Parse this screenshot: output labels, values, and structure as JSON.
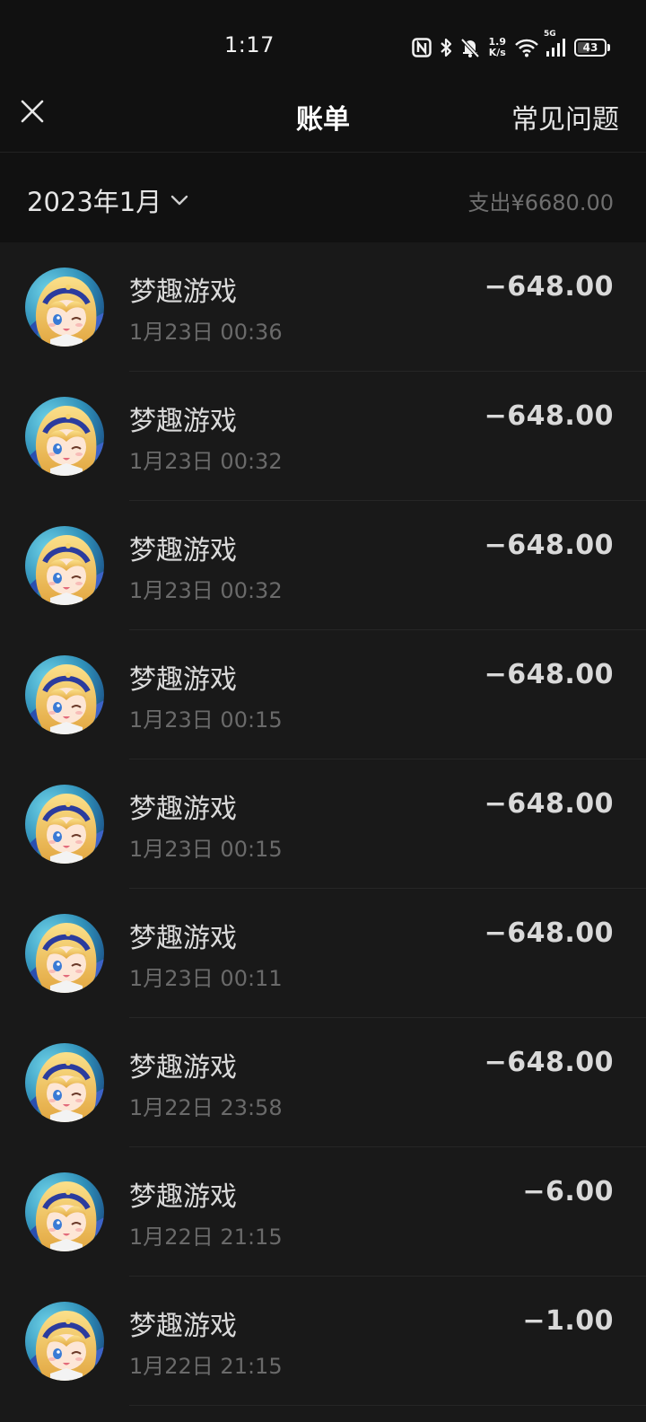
{
  "status_bar": {
    "time": "1:17",
    "net_speed_value": "1.9",
    "net_speed_unit": "K/s",
    "signal_label": "5G",
    "battery": "43",
    "icons": [
      "nfc-icon",
      "bluetooth-icon",
      "mute-bell-icon",
      "wifi-icon",
      "cellular-icon",
      "battery-icon"
    ]
  },
  "header": {
    "close_icon": "close-icon",
    "title": "账单",
    "faq_label": "常见问题"
  },
  "summary": {
    "month_label": "2023年1月",
    "month_icon": "chevron-down-icon",
    "expense_label": "支出¥6680.00"
  },
  "colors": {
    "background": "#191919",
    "header_bg": "#111111",
    "primary_text": "#dadada",
    "secondary_text": "#6a6a6a"
  },
  "bills": [
    {
      "merchant": "梦趣游戏",
      "time": "1月23日 00:36",
      "amount": "−648.00"
    },
    {
      "merchant": "梦趣游戏",
      "time": "1月23日 00:32",
      "amount": "−648.00"
    },
    {
      "merchant": "梦趣游戏",
      "time": "1月23日 00:32",
      "amount": "−648.00"
    },
    {
      "merchant": "梦趣游戏",
      "time": "1月23日 00:15",
      "amount": "−648.00"
    },
    {
      "merchant": "梦趣游戏",
      "time": "1月23日 00:15",
      "amount": "−648.00"
    },
    {
      "merchant": "梦趣游戏",
      "time": "1月23日 00:11",
      "amount": "−648.00"
    },
    {
      "merchant": "梦趣游戏",
      "time": "1月22日 23:58",
      "amount": "−648.00"
    },
    {
      "merchant": "梦趣游戏",
      "time": "1月22日 21:15",
      "amount": "−6.00"
    },
    {
      "merchant": "梦趣游戏",
      "time": "1月22日 21:15",
      "amount": "−1.00"
    }
  ]
}
